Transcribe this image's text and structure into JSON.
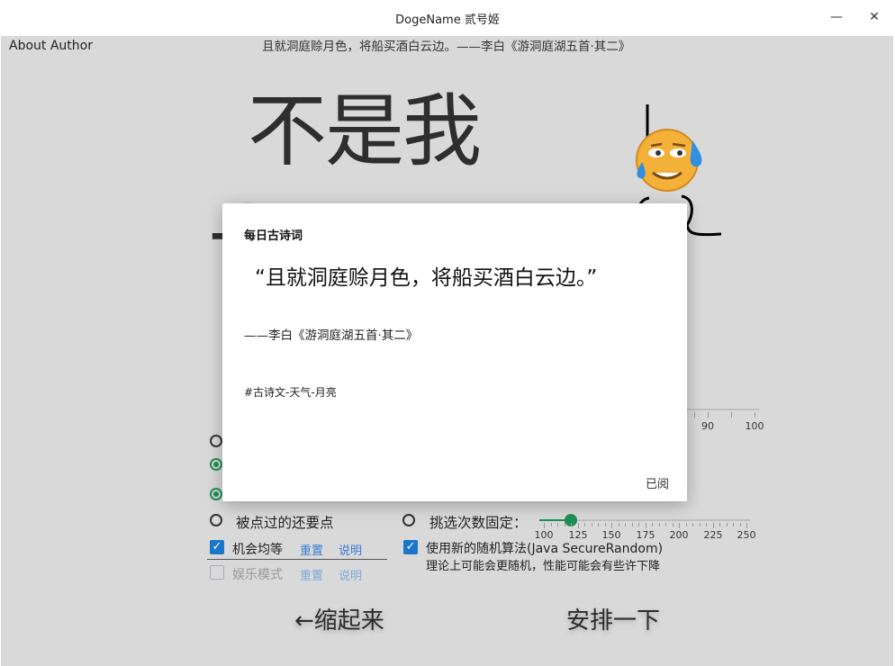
{
  "window": {
    "title": "DogeName 贰号姬",
    "minimize_glyph": "—",
    "close_glyph": "✕"
  },
  "header": {
    "about_link": "About Author",
    "top_quote": "且就洞庭赊月色，将船买酒白云边。——李白《游洞庭湖五首·其二》"
  },
  "main": {
    "big_name": "不是我",
    "big_name_partial": "十"
  },
  "options": {
    "radio_pick_again": "被点过的还要点",
    "radio_fixed_count": "挑选次数固定：",
    "check_equal_chance": "机会均等",
    "check_fun_mode": "娱乐模式",
    "check_secure_random": "使用新的随机算法(Java SecureRandom)",
    "secure_random_note": "理论上可能会更随机，性能可能会有些许下降",
    "reset_label": "重置",
    "explain_label": "说明"
  },
  "slider_top": {
    "tick_labels": [
      "90",
      "100"
    ]
  },
  "slider_count": {
    "value": 120,
    "min": 100,
    "max": 250,
    "tick_labels": [
      "100",
      "125",
      "150",
      "175",
      "200",
      "225",
      "250"
    ]
  },
  "actions": {
    "collapse": "←缩起来",
    "arrange": "安排一下"
  },
  "dialog": {
    "title": "每日古诗词",
    "quote": "“且就洞庭赊月色，将船买酒白云边。”",
    "author": "——李白《游洞庭湖五首·其二》",
    "tags": "#古诗文-天气-月亮",
    "read_button": "已阅"
  },
  "colors": {
    "accent_green": "#1f8f55",
    "checkbox_blue": "#1976c8",
    "link_blue": "#3a7bd5",
    "background": "#d9d9d9"
  }
}
